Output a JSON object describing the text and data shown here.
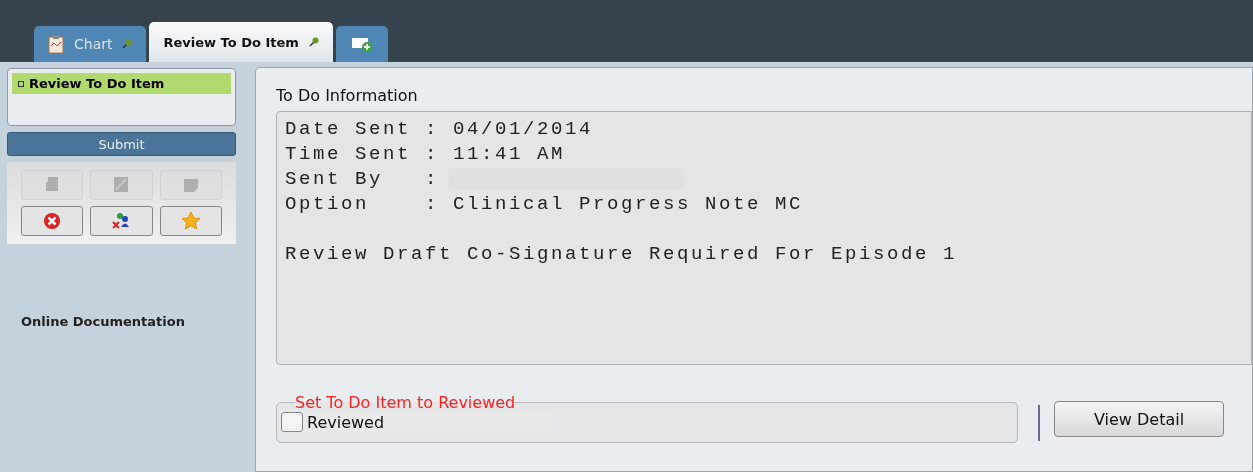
{
  "tabs": [
    {
      "label": "Chart",
      "selected": false
    },
    {
      "label": "Review To Do Item",
      "selected": true
    }
  ],
  "sidebar": {
    "items": [
      {
        "label": "Review To Do Item",
        "selected": true
      }
    ],
    "submit": "Submit",
    "toolbar": [
      {
        "disabled": true
      },
      {
        "disabled": true
      },
      {
        "disabled": true
      },
      {
        "disabled": false
      },
      {
        "disabled": false
      },
      {
        "disabled": false
      }
    ],
    "link": "Online Documentation"
  },
  "info": {
    "title": "To Do Information",
    "fields": [
      {
        "label": "Date Sent :",
        "value": "04/01/2014"
      },
      {
        "label": "Time Sent :",
        "value": "11:41 AM"
      },
      {
        "label": "Sent By   :"
      },
      {
        "label": "Option    :",
        "value": "Clinical Progress Note MC"
      }
    ],
    "message": "Review Draft Co-Signature Required For Episode 1"
  },
  "review": {
    "legend": "Set To Do Item to Reviewed",
    "checkbox": {
      "label": "Reviewed",
      "checked": false
    }
  },
  "view_button": "View Detail"
}
